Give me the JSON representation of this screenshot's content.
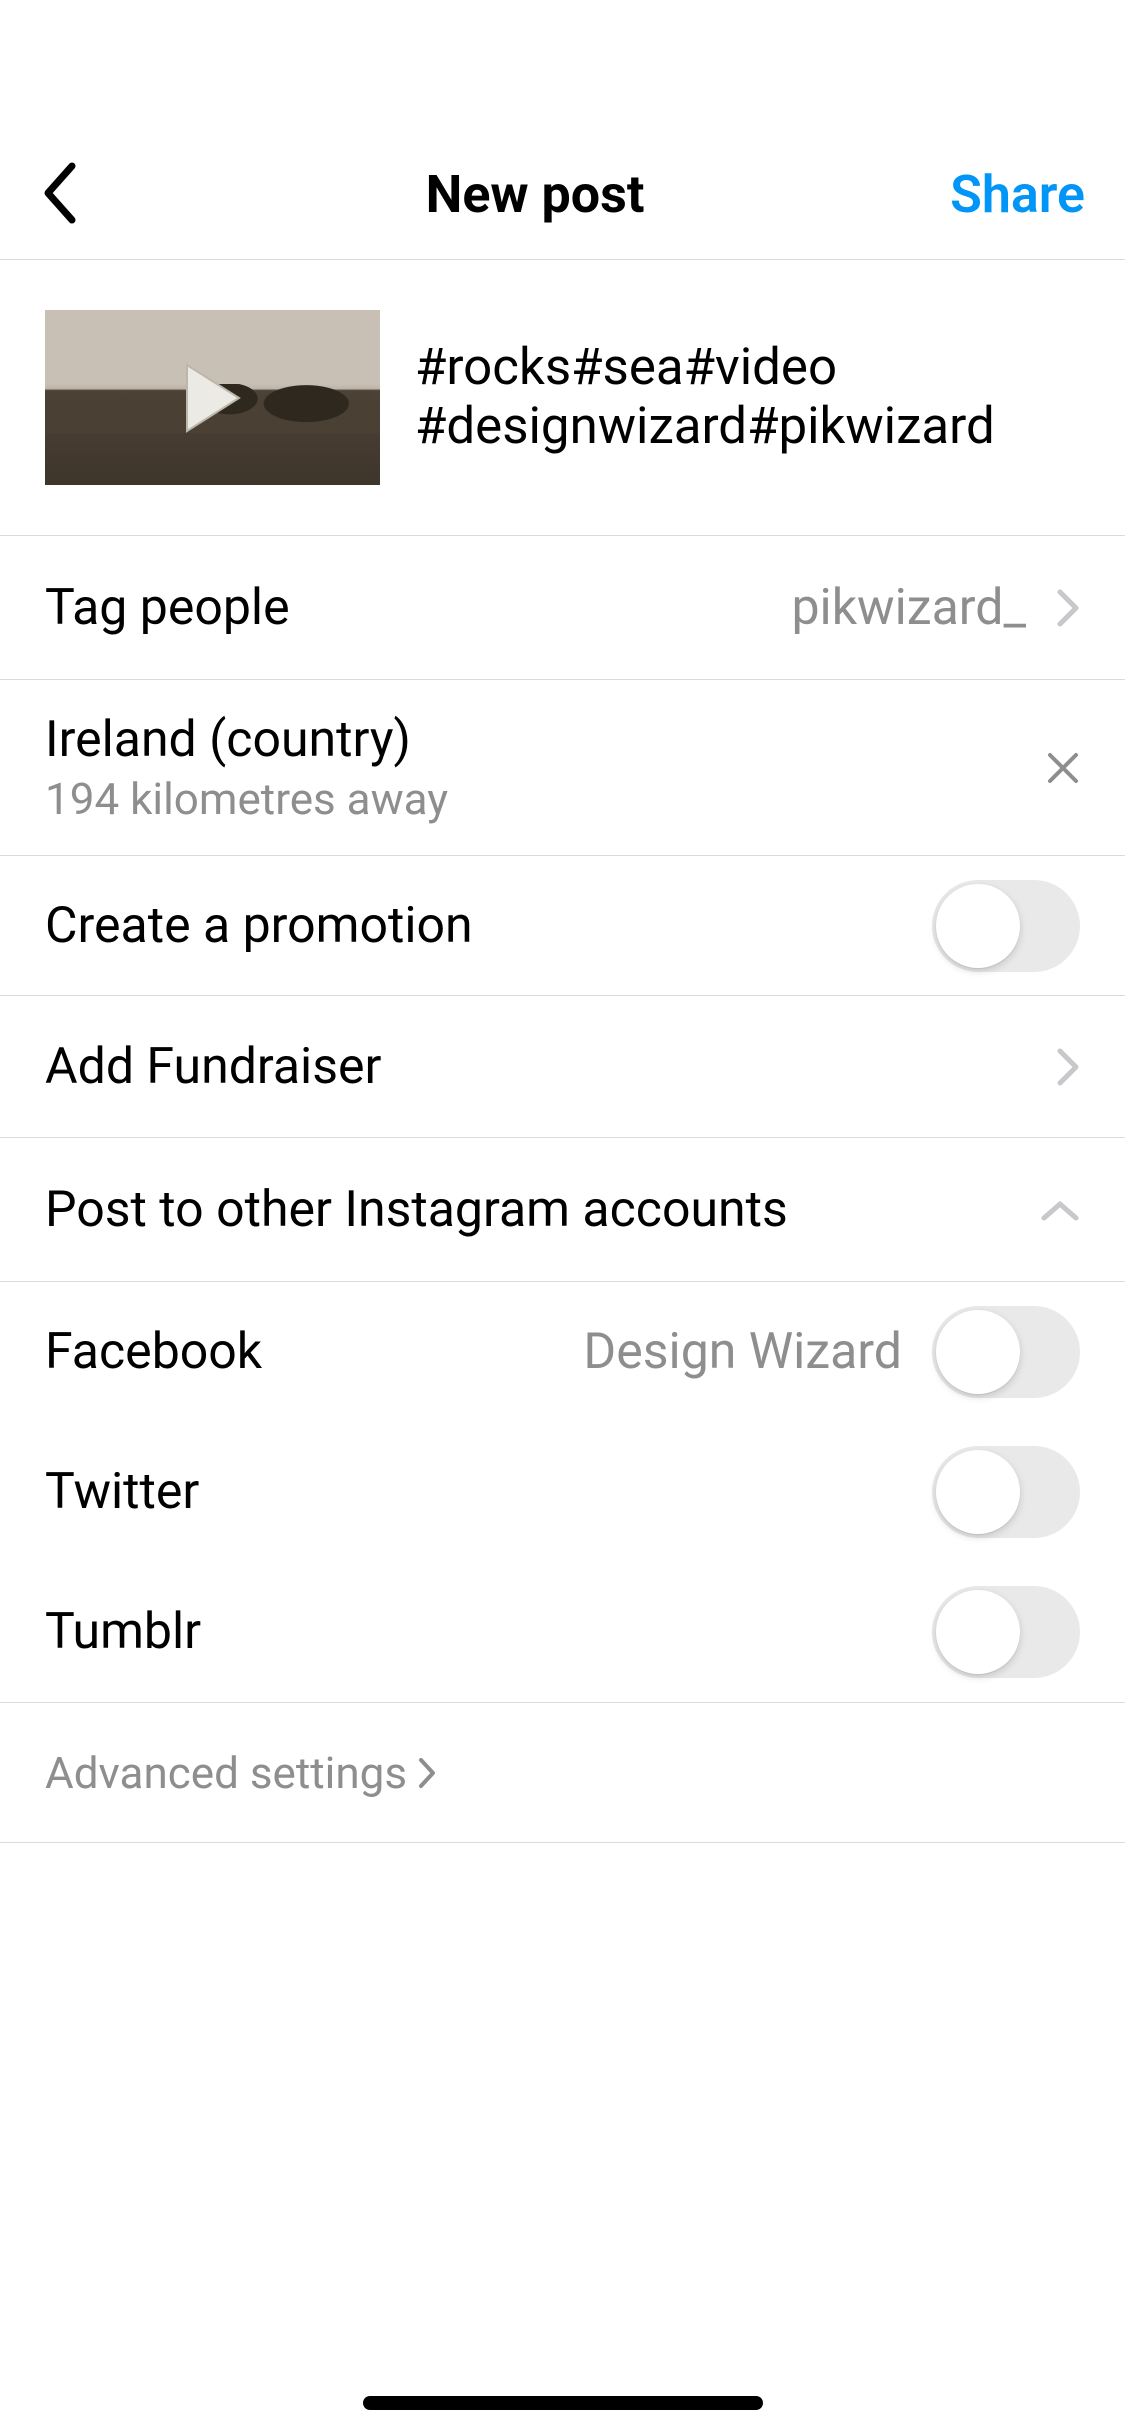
{
  "header": {
    "title": "New post",
    "share": "Share"
  },
  "caption": "#rocks#sea#video #designwizard#pikwizard",
  "tag_people": {
    "label": "Tag people",
    "value": "pikwizard_"
  },
  "location": {
    "name": "Ireland (country)",
    "distance": "194 kilometres away"
  },
  "promotion": {
    "label": "Create a promotion",
    "on": false
  },
  "fundraiser": {
    "label": "Add Fundraiser"
  },
  "post_other": {
    "label": "Post to other Instagram accounts",
    "expanded": true
  },
  "share_targets": [
    {
      "name": "Facebook",
      "account": "Design Wizard",
      "on": false
    },
    {
      "name": "Twitter",
      "account": "",
      "on": false
    },
    {
      "name": "Tumblr",
      "account": "",
      "on": false
    }
  ],
  "advanced": {
    "label": "Advanced settings"
  }
}
